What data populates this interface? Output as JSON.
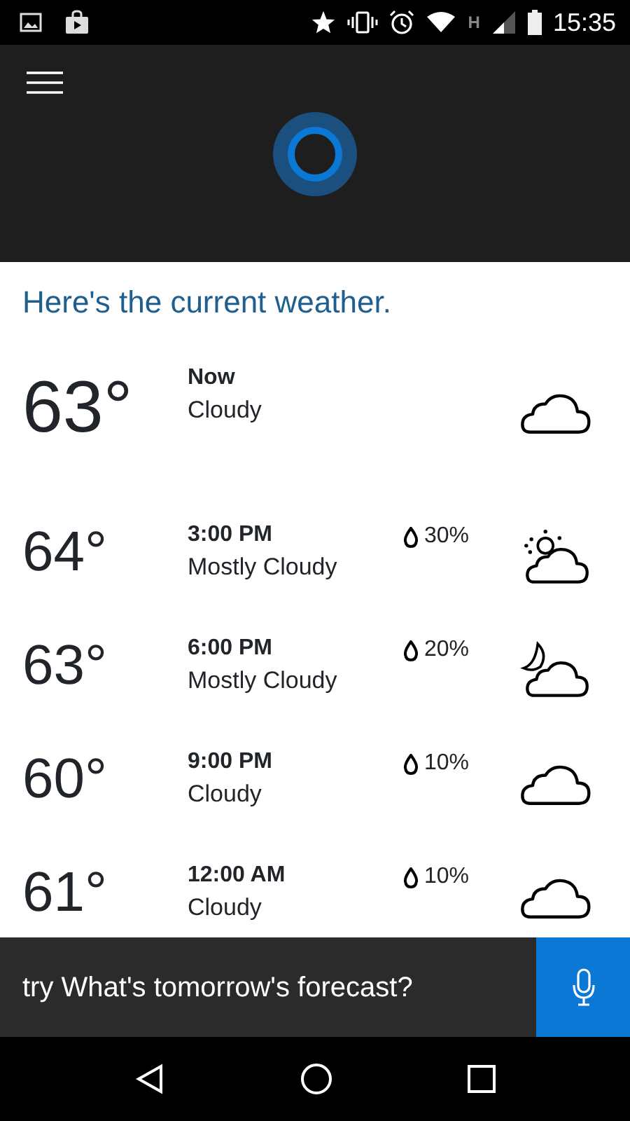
{
  "status_bar": {
    "time": "15:35",
    "network": "H"
  },
  "heading": "Here's the current weather.",
  "current": {
    "temperature": "63°",
    "label": "Now",
    "condition": "Cloudy",
    "kind": "cloudy"
  },
  "forecast": [
    {
      "temperature": "64°",
      "time": "3:00 PM",
      "condition": "Mostly Cloudy",
      "precipitation": "30%",
      "kind": "partly-sunny"
    },
    {
      "temperature": "63°",
      "time": "6:00 PM",
      "condition": "Mostly Cloudy",
      "precipitation": "20%",
      "kind": "partly-night"
    },
    {
      "temperature": "60°",
      "time": "9:00 PM",
      "condition": "Cloudy",
      "precipitation": "10%",
      "kind": "cloudy"
    },
    {
      "temperature": "61°",
      "time": "12:00 AM",
      "condition": "Cloudy",
      "precipitation": "10%",
      "kind": "cloudy"
    }
  ],
  "suggestion": "try What's tomorrow's forecast?"
}
